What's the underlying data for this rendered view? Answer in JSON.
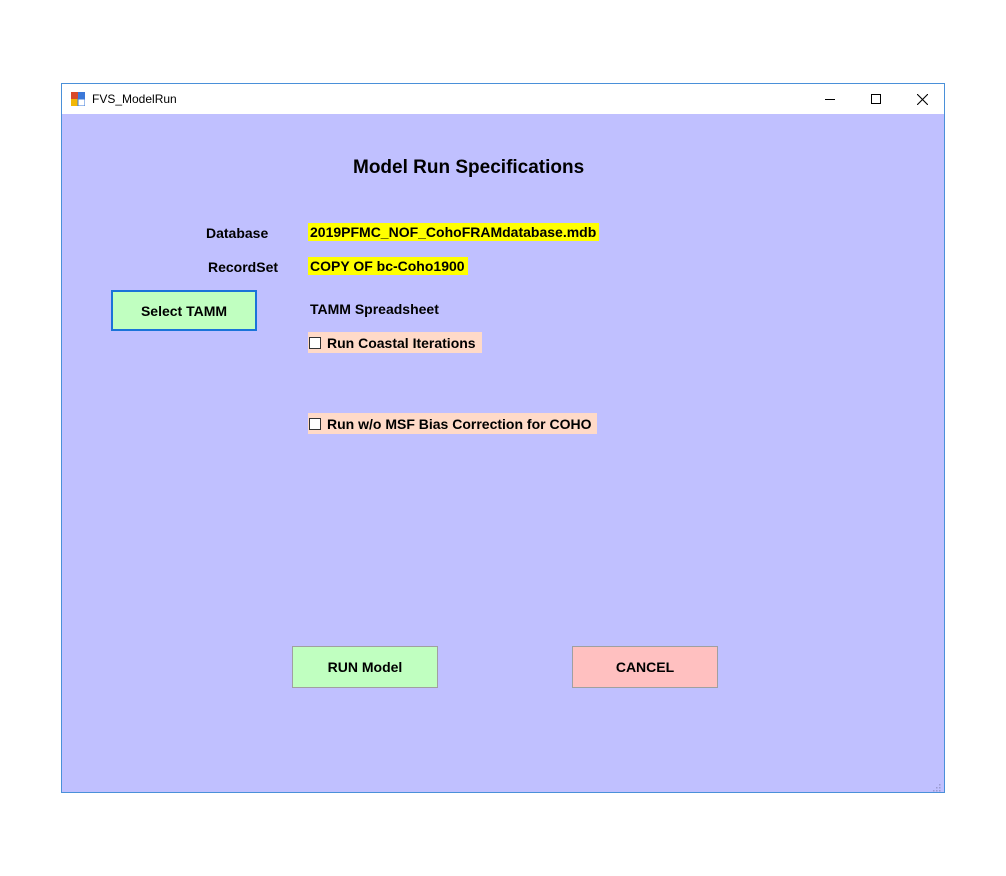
{
  "window": {
    "title": "FVS_ModelRun",
    "icon": "app-window-icon"
  },
  "title_bar_buttons": {
    "minimize_icon": "minimize-icon",
    "maximize_icon": "maximize-icon",
    "close_icon": "close-icon"
  },
  "form": {
    "heading": "Model Run Specifications",
    "database_label": "Database",
    "database_value": "2019PFMC_NOF_CohoFRAMdatabase.mdb",
    "recordset_label": "RecordSet",
    "recordset_value": "COPY OF bc-Coho1900",
    "select_tamm_label": "Select TAMM",
    "tamm_spreadsheet_label": "TAMM Spreadsheet",
    "coastal_iterations_label": "Run Coastal Iterations",
    "coastal_iterations_checked": false,
    "msf_bias_label": "Run w/o MSF Bias Correction for COHO",
    "msf_bias_checked": false,
    "run_model_label": "RUN Model",
    "cancel_label": "CANCEL"
  },
  "colors": {
    "client_background": "#c0c0ff",
    "value_highlight": "#ffff00",
    "checkbox_row_background": "#ffdac8",
    "run_button": "#c0ffc0",
    "cancel_button": "#ffc0c0",
    "select_tamm_border": "#1a73d9"
  }
}
